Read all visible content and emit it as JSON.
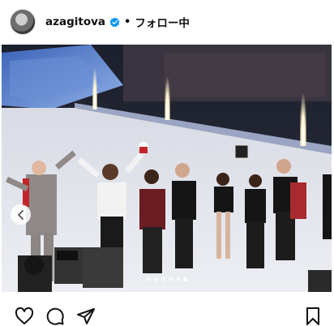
{
  "post_header": {
    "username": "azagitova",
    "separator": "•",
    "follow_state": "フォロー中"
  },
  "carousel": {
    "slide_count": 6,
    "active_index": 5
  },
  "colors": {
    "verified_badge": "#0095f6",
    "text": "#111111",
    "background": "#ffffff"
  },
  "icons": {
    "like": "heart-outline",
    "comment": "speech-bubble-outline",
    "share": "paper-plane-outline",
    "save": "bookmark-outline",
    "carousel_prev": "chevron-left"
  }
}
